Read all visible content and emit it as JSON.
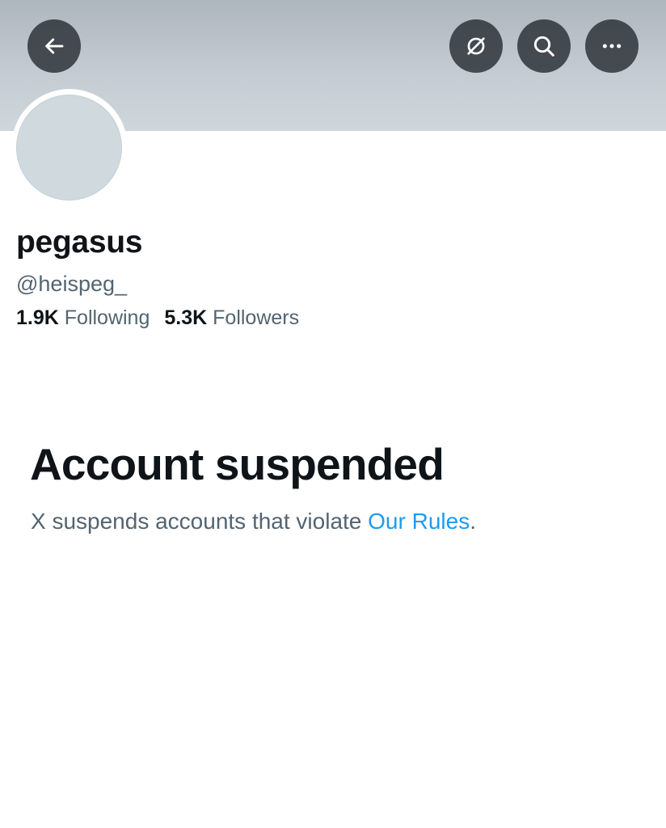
{
  "header": {
    "back_icon": "arrow-left-icon",
    "translate_icon": "translate-off-icon",
    "search_icon": "search-icon",
    "more_icon": "more-horizontal-icon",
    "banner_color": "#c4cbd2",
    "button_color": "#2f353b"
  },
  "profile": {
    "display_name": "pegasus",
    "handle": "@heispeg_",
    "following_count": "1.9K",
    "following_label": "Following",
    "followers_count": "5.3K",
    "followers_label": "Followers",
    "avatar_color": "#cfd9de"
  },
  "notice": {
    "title": "Account suspended",
    "text_before": "X suspends accounts that violate ",
    "link_text": "Our Rules",
    "text_after": ".",
    "link_color": "#1d9bf0"
  }
}
